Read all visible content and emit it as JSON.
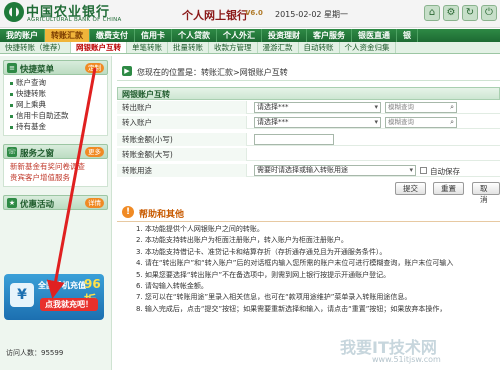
{
  "header": {
    "bank_name_cn": "中国农业银行",
    "bank_name_en": "AGRICULTURAL BANK OF CHINA",
    "product": "个人网上银行",
    "version": "V6.0",
    "date": "2015-02-02 星期一",
    "buttons": [
      "home-icon",
      "settings-icon",
      "refresh-icon",
      "power-icon"
    ]
  },
  "main_nav": {
    "tabs": [
      "我的账户",
      "转账汇款",
      "缴费支付",
      "信用卡",
      "个人贷款",
      "个人外汇",
      "投资理财",
      "客户服务",
      "银医直通",
      "银"
    ],
    "active": "转账汇款"
  },
  "sub_nav": {
    "tabs": [
      "快捷转账（推荐）",
      "网银账户互转",
      "单笔转账",
      "批量转账",
      "收款方管理",
      "漫游汇款",
      "自动转账",
      "个人资金归集"
    ],
    "active": "网银账户互转"
  },
  "sidebar": {
    "quick_menu": {
      "title": "快捷菜单",
      "badge": "定制",
      "items": [
        "账户查询",
        "快捷转账",
        "网上乘典",
        "信用卡自助还款",
        "持有基金"
      ]
    },
    "service": {
      "title": "服务之窗",
      "badge": "更多",
      "items": [
        "新新基金有奖问卷调查",
        "贵宾客户增值服务"
      ]
    },
    "promo_activity": {
      "title": "优惠活动",
      "badge": "详情"
    },
    "banner": {
      "text1": "全国手机充值",
      "amount": "96折",
      "text2": "点我就充吧！"
    },
    "visitors": "访问人数：95599"
  },
  "content": {
    "location": "您现在的位置是：转账汇款>网银账户互转",
    "form_title": "网银账户互转",
    "form": {
      "from_label": "转出账户",
      "from_value": "请选择***",
      "from_search_placeholder": "模糊查询",
      "to_label": "转入账户",
      "to_value": "请选择***",
      "to_search_placeholder": "模糊查询",
      "amount_small_label": "转账金额(小写)",
      "amount_large_label": "转账金额(大写)",
      "purpose_label": "转账用途",
      "purpose_value": "需要时请选择或输入转账用途",
      "auto_save_label": "自动保存"
    },
    "buttons": {
      "submit": "提交",
      "reset": "重置",
      "cancel": "取消"
    },
    "help": {
      "title": "帮助和其他",
      "items": [
        "1. 本功能提供个人网银账户之间的转账。",
        "2. 本功能支持转出账户为柜面注册账户，转入账户为柜面注册账户。",
        "3. 本功能支持借记卡、准贷记卡和结算存折（存折通存通兑且为开通服务条件）。",
        "4. 请在“转出账户”和“转入账户”后的对话框内输入您所需的账户末位可进行模糊查询，账户末位可输入",
        "5. 如果您要选择“转出账户”不在备选项中，则需到网上银行按提示开通账户登记。",
        "6. 请勾输入转帐金额。",
        "7. 您可以在“转账用途”里录入相关信息，也可在“款项用途维护”菜单录入转账用途信息。",
        "8. 输入完成后，点击“提交”按钮；如果需要重新选择和输入，请点击“重置”按钮；如果放弃本操作，"
      ]
    }
  },
  "watermark": {
    "text": "我要IT技术网",
    "url": "www.51itjsw.com"
  },
  "colors": {
    "brand_green": "#1f7a3a",
    "nav_active": "#f0b43a",
    "help_orange": "#c85a00",
    "annotation_red": "#e02020"
  }
}
